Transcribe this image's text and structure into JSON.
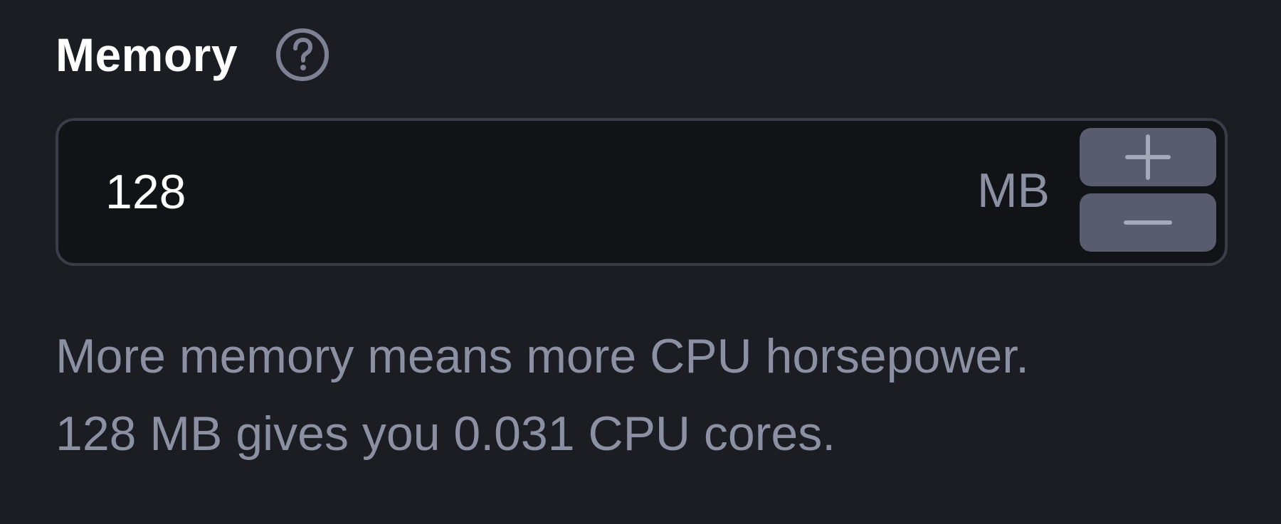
{
  "field": {
    "label": "Memory",
    "help_icon": "question-circle-icon",
    "value": "128",
    "unit": "MB",
    "increment_icon": "plus-icon",
    "decrement_icon": "minus-icon"
  },
  "help_text": {
    "line1": "More memory means more CPU horsepower.",
    "line2": "128 MB gives you 0.031 CPU cores."
  },
  "colors": {
    "background": "#1b1d22",
    "input_background": "#111316",
    "input_border": "#3a3d48",
    "stepper_button": "#585c6e",
    "muted_text": "#8b90a3",
    "primary_text": "#ffffff"
  }
}
